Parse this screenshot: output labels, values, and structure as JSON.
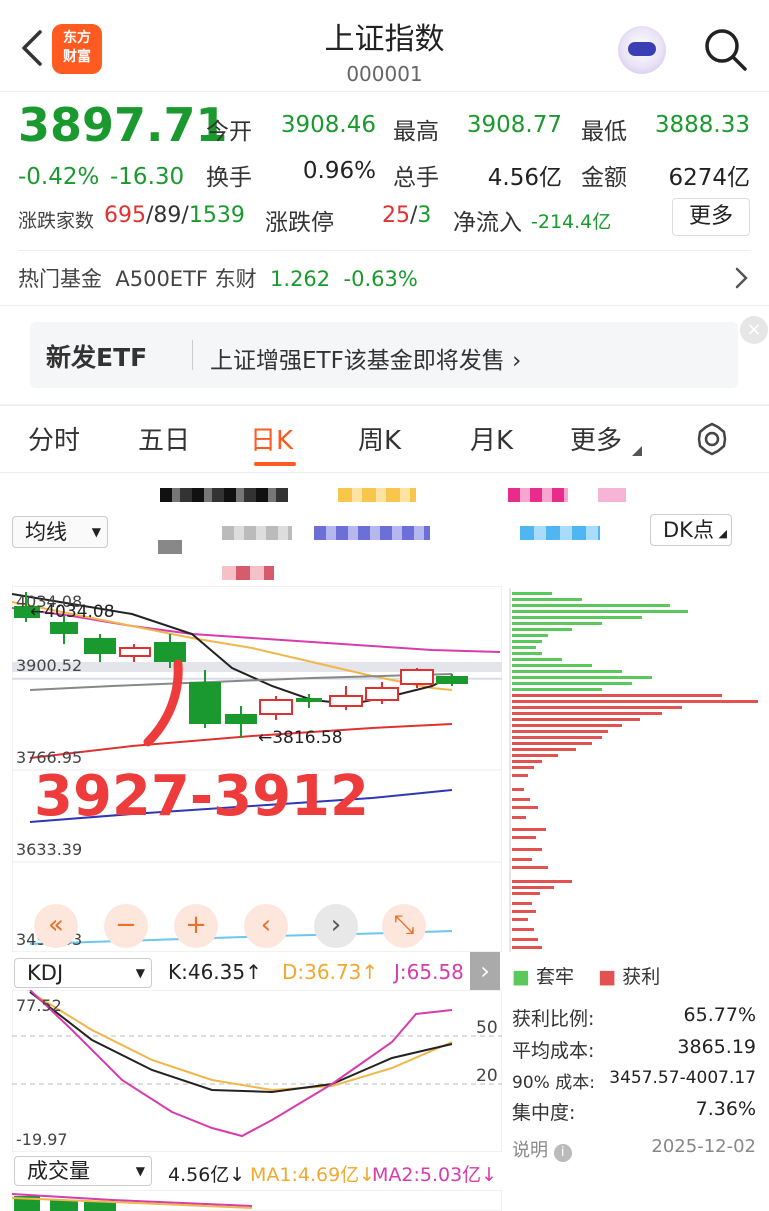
{
  "header": {
    "title": "上证指数",
    "code": "000001",
    "logo_line1": "东方",
    "logo_line2": "财富"
  },
  "quote": {
    "price": "3897.71",
    "pct": "-0.42%",
    "change": "-16.30",
    "open_label": "今开",
    "open": "3908.46",
    "high_label": "最高",
    "high": "3908.77",
    "low_label": "最低",
    "low": "3888.33",
    "turnover_label": "换手",
    "turnover": "0.96%",
    "volume_label": "总手",
    "volume": "4.56亿",
    "amount_label": "金额",
    "amount": "6274亿",
    "breadth_label": "涨跌家数",
    "breadth_up": "695",
    "breadth_flat": "/89/",
    "breadth_down": "1539",
    "limit_label": "涨跌停",
    "limit_up": "25",
    "limit_sep": "/",
    "limit_down": "3",
    "netflow_label": "净流入",
    "netflow": "-214.4亿",
    "more_label": "更多"
  },
  "fund": {
    "label": "热门基金",
    "name": "A500ETF 东财",
    "price": "1.262",
    "pct": "-0.63%"
  },
  "banner": {
    "tag": "新发ETF",
    "text": "上证增强ETF该基金即将发售 ›",
    "close": "×"
  },
  "tabs": [
    {
      "label": "分时"
    },
    {
      "label": "五日"
    },
    {
      "label": "日K"
    },
    {
      "label": "周K"
    },
    {
      "label": "月K"
    },
    {
      "label": "更多"
    }
  ],
  "indicator_select": "均线",
  "dk_label": "DK点",
  "chart": {
    "y_labels": [
      "4034.08",
      "3900.52",
      "3766.95",
      "3633.39",
      "3499.83"
    ],
    "high_mark": "←4034.08",
    "low_mark": "←3816.58",
    "annotation": "3927-3912"
  },
  "kdj": {
    "select": "KDJ",
    "k": "K:46.35↑",
    "d": "D:36.73↑",
    "j": "J:65.58",
    "top": "77.52",
    "bottom": "-19.97",
    "l50": "50",
    "l20": "20"
  },
  "volume_bar": {
    "select": "成交量",
    "value": "4.56亿↓",
    "ma1": "MA1:4.69亿↓",
    "ma2": "MA2:5.03亿↓"
  },
  "chip": {
    "legend_trap": "套牢",
    "legend_profit": "获利",
    "rows": [
      {
        "label": "获利比例:",
        "value": "65.77%"
      },
      {
        "label": "平均成本:",
        "value": "3865.19"
      },
      {
        "label": "90% 成本:",
        "value": "3457.57-4007.17"
      },
      {
        "label": "集中度:",
        "value": "7.36%"
      }
    ],
    "note": "说明",
    "date": "2025-12-02"
  },
  "colors": {
    "up": "#e03131",
    "down": "#1a9a2e",
    "accent": "#ff5a1f"
  }
}
